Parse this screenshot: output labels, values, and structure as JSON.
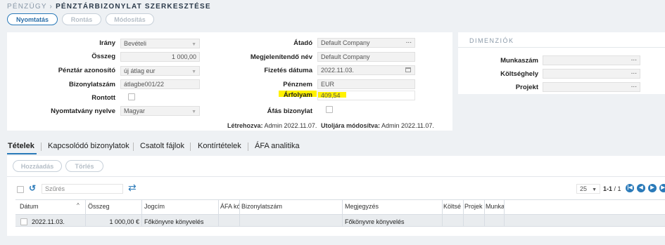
{
  "breadcrumb": {
    "parent": "PÉNZÜGY",
    "separator": " › ",
    "title": "PÉNZTÁRBIZONYLAT SZERKESZTÉSE"
  },
  "toolbar": {
    "print": "Nyomtatás",
    "cancel": "Rontás",
    "changes": "Módosítás"
  },
  "form": {
    "irany": {
      "label": "Irány",
      "value": "Bevételi"
    },
    "osszeg": {
      "label": "Összeg",
      "value": "1 000,00"
    },
    "penztar": {
      "label": "Pénztár azonosító",
      "value": "új átlag eur"
    },
    "bizonylatszam": {
      "label": "Bizonylatszám",
      "value": "átlagbe001/22"
    },
    "rontott": {
      "label": "Rontott"
    },
    "nyelv": {
      "label": "Nyomtatvány nyelve",
      "value": "Magyar"
    },
    "atado": {
      "label": "Átadó",
      "value": "Default Company",
      "dots": "..."
    },
    "megjelenito": {
      "label": "Megjelenítendő név",
      "value": "Default Company"
    },
    "fizetes": {
      "label": "Fizetés dátuma",
      "value": "2022.11.03."
    },
    "penznem": {
      "label": "Pénznem",
      "value": "EUR"
    },
    "arfolyam": {
      "label": "Árfolyam",
      "value": "409,54"
    },
    "afas": {
      "label": "Áfás bizonylat"
    },
    "created_label": "Létrehozva:",
    "created_value": "Admin 2022.11.07.",
    "modified_label": "Utoljára módosítva:",
    "modified_value": "Admin 2022.11.07."
  },
  "dimensions": {
    "title": "DIMENZIÓK",
    "munkaszam": "Munkaszám",
    "koltseghely": "Költséghely",
    "projekt": "Projekt",
    "dots": "..."
  },
  "tabs": [
    "Tételek",
    "Kapcsolódó bizonylatok",
    "Csatolt fájlok",
    "Kontírtételek",
    "ÁFA analitika"
  ],
  "items": {
    "add": "Hozzáadás",
    "delete": "Törlés",
    "filter_placeholder": "Szűrés",
    "page_size": "25",
    "page_info": "1-1",
    "page_total": "/ 1",
    "columns": [
      "Dátum",
      "Összeg",
      "Jogcím",
      "ÁFA kó",
      "Bizonylatszám",
      "Megjegyzés",
      "Költsé",
      "Projek",
      "Munka"
    ],
    "rows": [
      {
        "datum": "2022.11.03.",
        "osszeg": "1 000,00 €",
        "jogcim": "Főkönyvre könyvelés",
        "megjegyzes": "Főkönyvre könyvelés"
      }
    ]
  },
  "colors": {
    "accent": "#2a7ab9",
    "highlight": "#fff100"
  }
}
